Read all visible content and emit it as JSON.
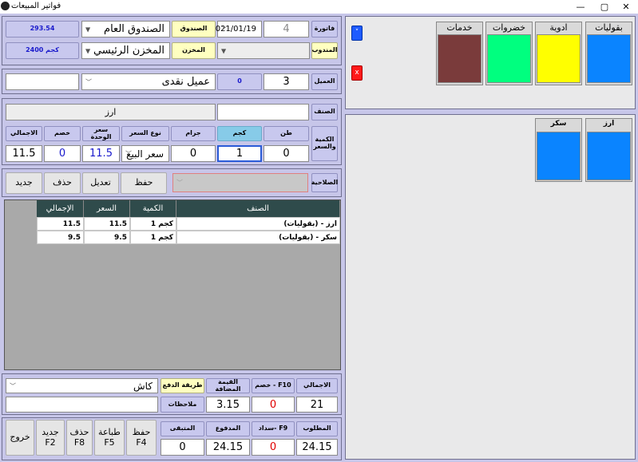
{
  "window": {
    "title": "فواتير المبيعات",
    "min_glyph": "—",
    "max_glyph": "▢",
    "close_glyph": "✕"
  },
  "header": {
    "invoice_label": "فاتورة",
    "invoice_no": "4",
    "date": "2021/01/19",
    "cashbox_label": "الصندوق",
    "cashbox": "الصندوق العام",
    "cashbox_balance": "293.54",
    "rep_label": "المندوب",
    "rep": "",
    "store_label": "المخزن",
    "store": "المخزن الرئيسي",
    "store_qty": "2400 كجم"
  },
  "customer": {
    "label": "العميل",
    "id": "3",
    "badge": "0",
    "name": "عميل نقدى",
    "extra": ""
  },
  "item": {
    "label": "الصنف",
    "code": "",
    "name": "ارز"
  },
  "qty": {
    "label": "الكمية والسعر",
    "headers": {
      "ton": "طن",
      "kg": "كجم",
      "gram": "جرام",
      "price_type": "نوع السعر",
      "unit_price": "سعر الوحدة",
      "discount": "خصم",
      "total": "الاجمالي"
    },
    "values": {
      "ton": "0",
      "kg": "1",
      "gram": "0",
      "price_type": "سعر البيع",
      "unit_price": "11.5",
      "discount": "0",
      "total": "11.5"
    }
  },
  "expiry": {
    "label": "الصلاحية",
    "value": ""
  },
  "actions": {
    "save": "حفظ",
    "edit": "تعديل",
    "delete": "حذف",
    "new": "جديد"
  },
  "table": {
    "headers": {
      "item": "الصنف",
      "qty": "الكمية",
      "price": "السعر",
      "total": "الإجمالي"
    },
    "rows": [
      {
        "item": "(بقوليات) - ارز",
        "qty": "1 كجم",
        "price": "11.5",
        "total": "11.5"
      },
      {
        "item": "(بقوليات) - سكر",
        "qty": "1 كجم",
        "price": "9.5",
        "total": "9.5"
      }
    ]
  },
  "totals": {
    "total_label": "الاجمالي",
    "total": "21",
    "discount_label": "خصم - F10",
    "discount": "0",
    "vat_label": "القيمة المضافة",
    "vat": "3.15",
    "payment_label": "طريقة الدفع",
    "payment": "كاش",
    "notes_label": "ملاحظات",
    "notes": "",
    "required_label": "المطلوب",
    "required": "24.15",
    "pay_label": "سداد- F9",
    "pay": "0",
    "paid_label": "المدفوع",
    "paid": "24.15",
    "remaining_label": "المتبقى",
    "remaining": "0"
  },
  "bottom_buttons": {
    "save": "حفظ\nF4",
    "print": "طباعة\nF5",
    "delete": "حذف\nF8",
    "new": "جديد\nF2",
    "exit": "خروج"
  },
  "categories": [
    {
      "name": "بقوليات",
      "color": "#0a84ff"
    },
    {
      "name": "ادوية",
      "color": "#ffff00"
    },
    {
      "name": "خضروات",
      "color": "#00ff7f"
    },
    {
      "name": "خدمات",
      "color": "#7a3b3b"
    }
  ],
  "products": [
    {
      "name": "ارز",
      "color": "#0a84ff"
    },
    {
      "name": "سكر",
      "color": "#0a84ff"
    }
  ],
  "side_buttons": {
    "up": "˅",
    "close": "x"
  }
}
